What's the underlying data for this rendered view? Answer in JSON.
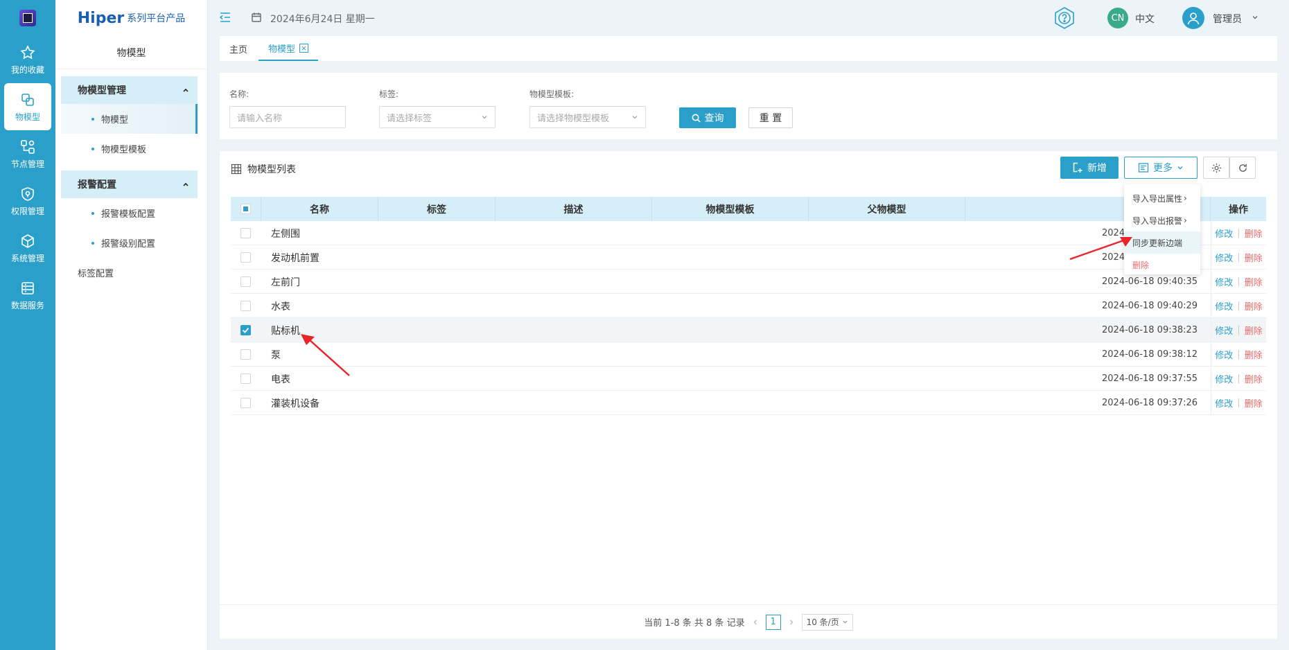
{
  "rail": {
    "items": [
      {
        "label": "我的收藏",
        "icon": "star-icon"
      },
      {
        "label": "物模型",
        "icon": "model-icon",
        "active": true
      },
      {
        "label": "节点管理",
        "icon": "node-icon"
      },
      {
        "label": "权限管理",
        "icon": "shield-icon"
      },
      {
        "label": "系统管理",
        "icon": "cube-icon"
      },
      {
        "label": "数据服务",
        "icon": "database-icon"
      }
    ]
  },
  "menu": {
    "brand_main": "Hiper",
    "brand_sub": "系列平台产品",
    "title": "物模型",
    "group1": "物模型管理",
    "group1_items": [
      "物模型",
      "物模型模板"
    ],
    "group2": "报警配置",
    "group2_items": [
      "报警模板配置",
      "报警级别配置"
    ],
    "plain_item": "标签配置"
  },
  "topbar": {
    "date": "2024年6月24日 星期一",
    "lang_badge": "CN",
    "lang": "中文",
    "user": "管理员"
  },
  "tabs": [
    "主页",
    "物模型"
  ],
  "filter": {
    "name_label": "名称:",
    "name_placeholder": "请输入名称",
    "tag_label": "标签:",
    "tag_placeholder": "请选择标签",
    "template_label": "物模型模板:",
    "template_placeholder": "请选择物模型模板",
    "query_button": "查询",
    "reset_button": "重 置"
  },
  "list": {
    "title": "物模型列表",
    "add_button": "新增",
    "more_button": "更多",
    "columns": [
      "名称",
      "标签",
      "描述",
      "物模型模板",
      "父物模型",
      "操作"
    ],
    "rows": [
      {
        "name": "左侧围",
        "time": "2024",
        "selected": false
      },
      {
        "name": "发动机前置",
        "time": "2024",
        "selected": false
      },
      {
        "name": "左前门",
        "time": "2024-06-18 09:40:35",
        "selected": false
      },
      {
        "name": "水表",
        "time": "2024-06-18 09:40:29",
        "selected": false
      },
      {
        "name": "贴标机",
        "time": "2024-06-18 09:38:23",
        "selected": true
      },
      {
        "name": "泵",
        "time": "2024-06-18 09:38:12",
        "selected": false
      },
      {
        "name": "电表",
        "time": "2024-06-18 09:37:55",
        "selected": false
      },
      {
        "name": "灌装机设备",
        "time": "2024-06-18 09:37:26",
        "selected": false
      }
    ],
    "edit_label": "修改",
    "delete_label": "删除"
  },
  "dropdown": {
    "items": [
      "导入导出属性",
      "导入导出报警",
      "同步更新边端",
      "删除"
    ]
  },
  "pager": {
    "summary": "当前 1-8 条 共 8 条 记录",
    "page": "1",
    "page_size": "10 条/页"
  },
  "colors": {
    "primary": "#2a9fca",
    "danger": "#f06a6a",
    "annotation": "#e8262a"
  }
}
